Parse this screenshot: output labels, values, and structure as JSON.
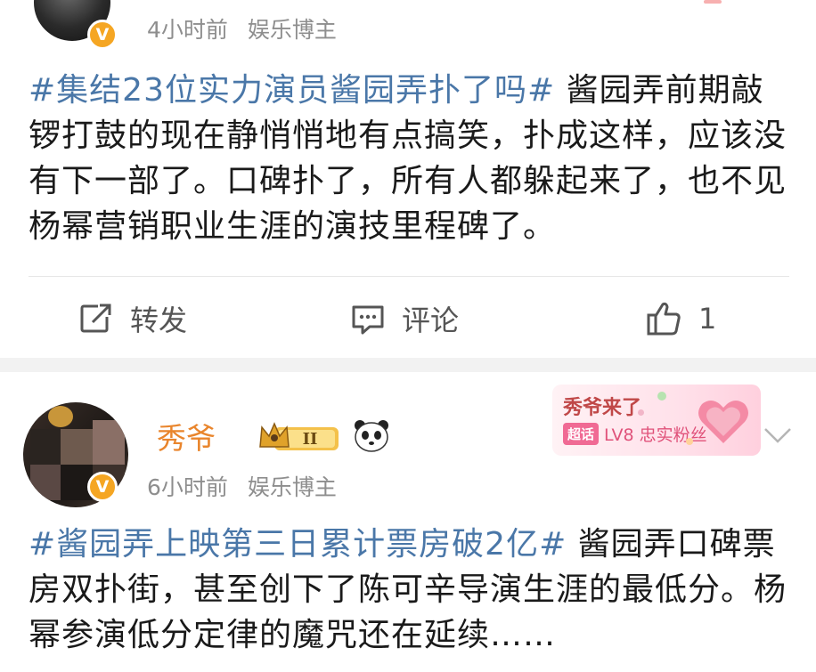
{
  "posts": [
    {
      "time": "4小时前",
      "source": "娱乐博主",
      "topic": "#集结23位实力演员酱园弄扑了吗#",
      "body": " 酱园弄前期敲锣打鼓的现在静悄悄地有点搞笑，扑成这样，应该没有下一部了。口碑扑了，所有人都躲起来了，也不见杨幂营销职业生涯的演技里程碑了。",
      "actions": {
        "repost_label": "转发",
        "comment_label": "评论",
        "like_count": "1"
      }
    },
    {
      "username": "秀爷",
      "time": "6小时前",
      "source": "娱乐博主",
      "topic": "#酱园弄上映第三日累计票房破2亿#",
      "body": " 酱园弄口碑票房双扑街，甚至创下了陈可辛导演生涯的最低分。杨幂参演低分定律的魔咒还在延续……",
      "fan_card": {
        "name": "秀爷来了",
        "tag": "超话",
        "level": "LV8 忠实粉丝"
      },
      "crown_badge": "II"
    }
  ],
  "icons": {
    "verified": "verified-v-icon",
    "repost": "repost-icon",
    "comment": "comment-icon",
    "like": "thumbs-up-icon",
    "expand": "chevron-down-icon"
  },
  "colors": {
    "topic": "#4a77a8",
    "meta": "#8e8e8e",
    "username": "#e9852c",
    "verified": "#f5a623"
  }
}
